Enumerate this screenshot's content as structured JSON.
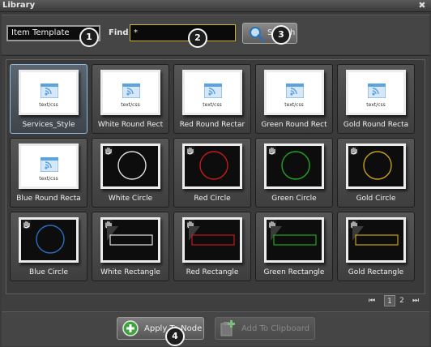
{
  "window": {
    "title": "Library",
    "close_glyph": "✖"
  },
  "toolbar": {
    "template_value": "Item Template",
    "find_label": "Find",
    "find_value": "*",
    "search_label": "Search"
  },
  "badges": [
    "1",
    "2",
    "3",
    "4"
  ],
  "tiles": [
    {
      "name": "Services_Style",
      "kind": "css",
      "doc_text": "text/css",
      "selected": true
    },
    {
      "name": "White Round Rect",
      "kind": "css",
      "doc_text": "text/css"
    },
    {
      "name": "Red Round Rectar",
      "kind": "css",
      "doc_text": "text/css"
    },
    {
      "name": "Green Round Rect",
      "kind": "css",
      "doc_text": "text/css"
    },
    {
      "name": "Gold Round Recta",
      "kind": "css",
      "doc_text": "text/css"
    },
    {
      "name": "Blue Round Recta",
      "kind": "css",
      "doc_text": "text/css"
    },
    {
      "name": "White Circle",
      "kind": "circle",
      "color": "#e0e0e0"
    },
    {
      "name": "Red Circle",
      "kind": "circle",
      "color": "#c41a1a"
    },
    {
      "name": "Green Circle",
      "kind": "circle",
      "color": "#1fa51f"
    },
    {
      "name": "Gold Circle",
      "kind": "circle",
      "color": "#c9a21a"
    },
    {
      "name": "Blue Circle",
      "kind": "circle",
      "color": "#2a6fc4"
    },
    {
      "name": "White Rectangle",
      "kind": "rect",
      "color": "#e0e0e0"
    },
    {
      "name": "Red Rectangle",
      "kind": "rect",
      "color": "#c41a1a"
    },
    {
      "name": "Green Rectangle",
      "kind": "rect",
      "color": "#1fa51f"
    },
    {
      "name": "Gold Rectangle",
      "kind": "rect",
      "color": "#c9a21a"
    }
  ],
  "pager": {
    "first": "⏮",
    "pages": [
      "1",
      "2"
    ],
    "current": "1",
    "last": "⏭"
  },
  "footer": {
    "apply_label": "Apply To Node",
    "clipboard_label": "Add To Clipboard"
  },
  "colors": {
    "accent_selected": "#8ec0e6",
    "find_border": "#c8b431",
    "rss_icon": "#5aa2e0"
  }
}
